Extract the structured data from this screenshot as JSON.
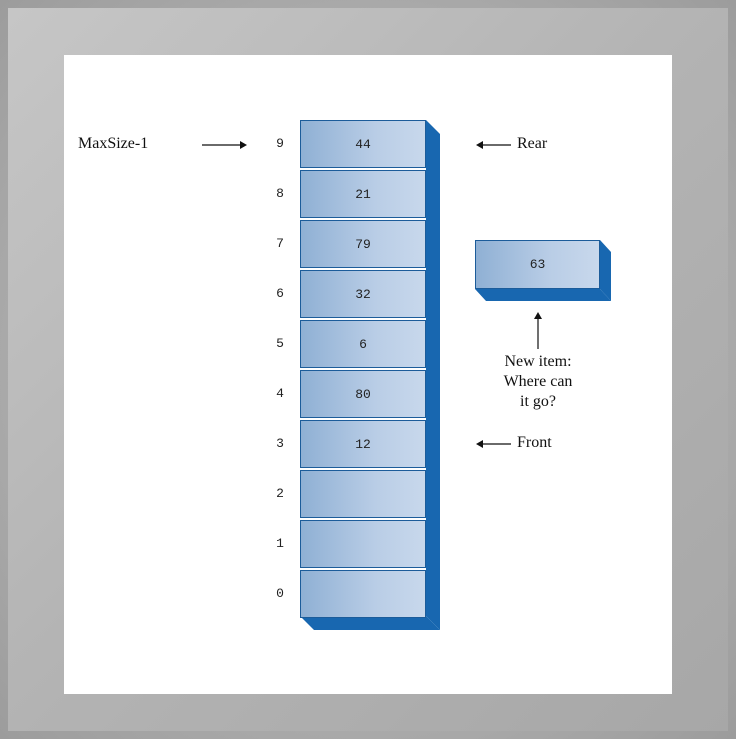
{
  "diagram": {
    "labels": {
      "maxsize": "MaxSize-1",
      "rear": "Rear",
      "front": "Front",
      "new_item_line1": "New item:",
      "new_item_line2": "Where can",
      "new_item_line3": "it go?"
    },
    "cells": [
      {
        "index": "9",
        "value": "44"
      },
      {
        "index": "8",
        "value": "21"
      },
      {
        "index": "7",
        "value": "79"
      },
      {
        "index": "6",
        "value": "32"
      },
      {
        "index": "5",
        "value": "6"
      },
      {
        "index": "4",
        "value": "80"
      },
      {
        "index": "3",
        "value": "12"
      },
      {
        "index": "2",
        "value": ""
      },
      {
        "index": "1",
        "value": ""
      },
      {
        "index": "0",
        "value": ""
      }
    ],
    "new_item_value": "63",
    "colors": {
      "cell_border": "#1c5c9a",
      "shadow": "#1867b0",
      "cell_fill_light": "#c8d8ec",
      "cell_fill_dark": "#8fb0d4"
    }
  }
}
